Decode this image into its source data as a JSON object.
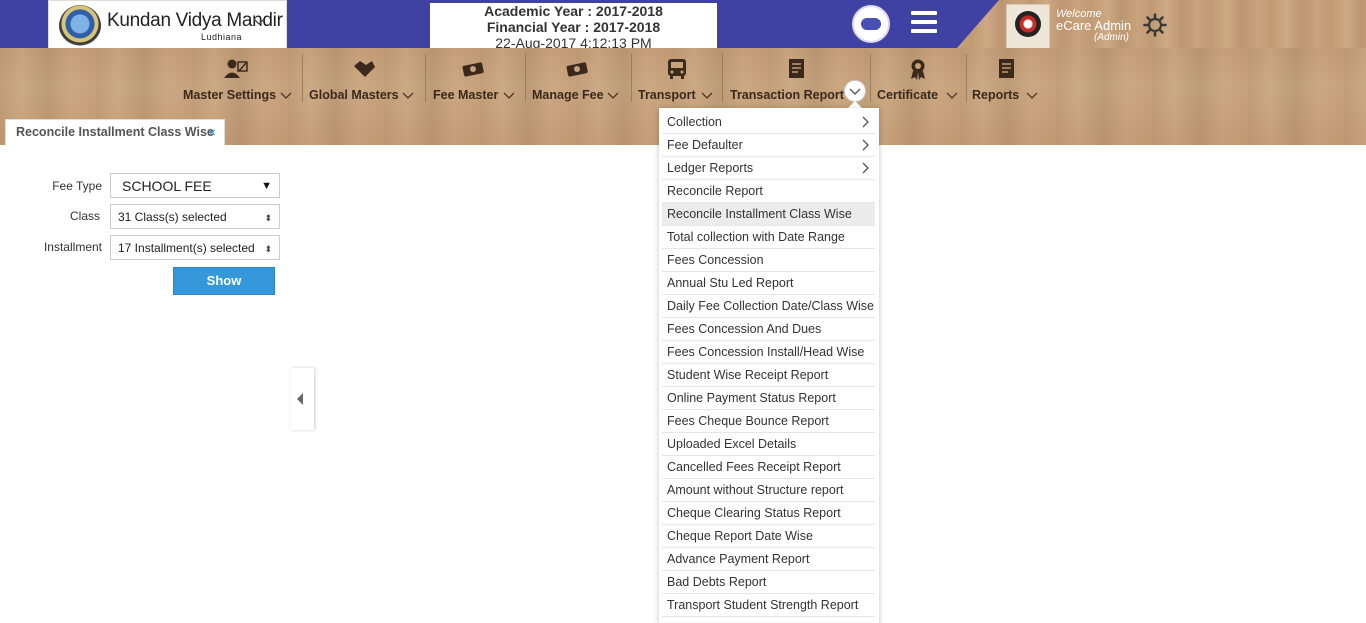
{
  "header": {
    "school_name": "Kundan Vidya Mandir",
    "school_city": "Ludhiana",
    "academic_year": "Academic Year : 2017-2018",
    "financial_year": "Financial Year : 2017-2018",
    "datetime": "22-Aug-2017 4:12:13 PM",
    "welcome": "Welcome",
    "user_name": "eCare Admin",
    "user_role": "(Admin)"
  },
  "menu": {
    "items": [
      {
        "label": "Master Settings",
        "icon": "user-edit-icon"
      },
      {
        "label": "Global Masters",
        "icon": "handshake-icon"
      },
      {
        "label": "Fee Master",
        "icon": "money-icon"
      },
      {
        "label": "Manage Fee",
        "icon": "money-icon"
      },
      {
        "label": "Transport",
        "icon": "bus-icon"
      },
      {
        "label": "Transaction Report",
        "icon": "document-icon"
      },
      {
        "label": "Certificate",
        "icon": "award-icon"
      },
      {
        "label": "Reports",
        "icon": "document-icon"
      }
    ]
  },
  "tab": {
    "label": "Reconcile Installment Class Wise",
    "close": "×"
  },
  "form": {
    "fee_type_label": "Fee Type",
    "fee_type_value": "SCHOOL FEE",
    "class_label": "Class",
    "class_value": "31 Class(s) selected",
    "installment_label": "Installment",
    "installment_value": "17 Installment(s) selected",
    "show_button": "Show"
  },
  "dropdown": {
    "items": [
      {
        "label": "Collection",
        "submenu": true
      },
      {
        "label": "Fee Defaulter",
        "submenu": true
      },
      {
        "label": "Ledger Reports",
        "submenu": true
      },
      {
        "label": "Reconcile Report"
      },
      {
        "label": "Reconcile Installment Class Wise",
        "highlighted": true
      },
      {
        "label": "Total collection with Date Range"
      },
      {
        "label": "Fees Concession"
      },
      {
        "label": "Annual Stu Led Report"
      },
      {
        "label": "Daily Fee Collection Date/Class Wise"
      },
      {
        "label": "Fees Concession And Dues"
      },
      {
        "label": "Fees Concession Install/Head Wise"
      },
      {
        "label": "Student Wise Receipt Report"
      },
      {
        "label": "Online Payment Status Report"
      },
      {
        "label": "Fees Cheque Bounce Report"
      },
      {
        "label": "Uploaded Excel Details"
      },
      {
        "label": "Cancelled Fees Receipt Report"
      },
      {
        "label": "Amount without Structure report"
      },
      {
        "label": "Cheque Clearing Status Report"
      },
      {
        "label": "Cheque Report Date Wise"
      },
      {
        "label": "Advance Payment Report"
      },
      {
        "label": "Bad Debts Report"
      },
      {
        "label": "Transport Student Strength Report"
      }
    ]
  },
  "colors": {
    "header_blue": "#3f41a3",
    "button_blue": "#3498db",
    "tab_close": "#3b8fd0"
  }
}
